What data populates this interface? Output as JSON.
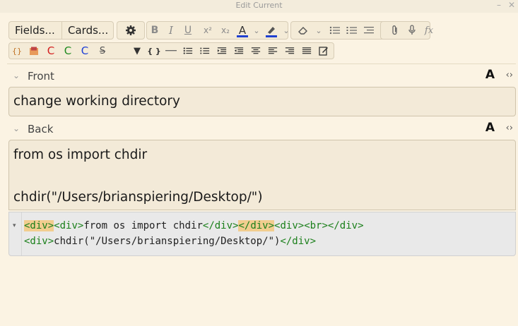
{
  "window": {
    "title": "Edit Current",
    "minimize": "–",
    "close": "✕"
  },
  "toolbar": {
    "fields_label": "Fields...",
    "cards_label": "Cards...",
    "settings_icon": "gear-icon",
    "row1_icons": [
      "bold",
      "italic",
      "underline",
      "superscript",
      "subscript",
      "text-color",
      "dropdown",
      "highlight",
      "dropdown",
      "eraser",
      "dropdown",
      "bullet-list",
      "numbered-list",
      "indent",
      "attach",
      "record-audio",
      "formula"
    ],
    "row2_icons": [
      "cloze-braces",
      "image-occlusion",
      "cloze-red",
      "cloze-green",
      "cloze-blue",
      "strikethrough",
      "blank",
      "triangle-down",
      "code-braces",
      "horizontal-rule",
      "bullet-list",
      "numbered-list",
      "indent",
      "outdent",
      "align-center",
      "align-left",
      "align-right",
      "justify",
      "edit-html"
    ]
  },
  "glyphs": {
    "bold": "B",
    "italic": "I",
    "underline": "U",
    "superscript": "x²",
    "subscript": "x₂",
    "text_color": "A",
    "caret": "⌄",
    "formula": "fx",
    "cloze": "C",
    "strike": "S",
    "triangle": "▼",
    "braces": "{ }",
    "cloze_braces": "{}",
    "big_a": "A",
    "code": "‹›",
    "chev": "⌄",
    "fold": "▾"
  },
  "colors": {
    "cloze_red": "#d42020",
    "cloze_green": "#1f8a1f",
    "cloze_blue": "#1d3fd6",
    "text_color_bar": "#2040d0",
    "highlight_bar": "#2040d0"
  },
  "fields": [
    {
      "name": "Front",
      "value": "change working directory"
    },
    {
      "name": "Back",
      "lines": [
        "from os import chdir",
        "",
        "chdir(\"/Users/brianspiering/Desktop/\")"
      ]
    }
  ],
  "html_editor": {
    "line1": [
      {
        "t": "<div>",
        "kind": "tag",
        "hl": true
      },
      {
        "t": "<div>",
        "kind": "tag",
        "hl": false
      },
      {
        "t": "from os import chdir",
        "kind": "text",
        "hl": false
      },
      {
        "t": "</div>",
        "kind": "tag",
        "hl": false
      },
      {
        "t": "</div>",
        "kind": "tag",
        "hl": true
      },
      {
        "t": "<div>",
        "kind": "tag",
        "hl": false
      },
      {
        "t": "<br>",
        "kind": "tag",
        "hl": false
      },
      {
        "t": "</div>",
        "kind": "tag",
        "hl": false
      }
    ],
    "line2": [
      {
        "t": "<div>",
        "kind": "tag",
        "hl": false
      },
      {
        "t": "chdir(\"/Users/brianspiering/Desktop/\")",
        "kind": "text",
        "hl": false
      },
      {
        "t": "</div>",
        "kind": "tag",
        "hl": false
      }
    ]
  }
}
